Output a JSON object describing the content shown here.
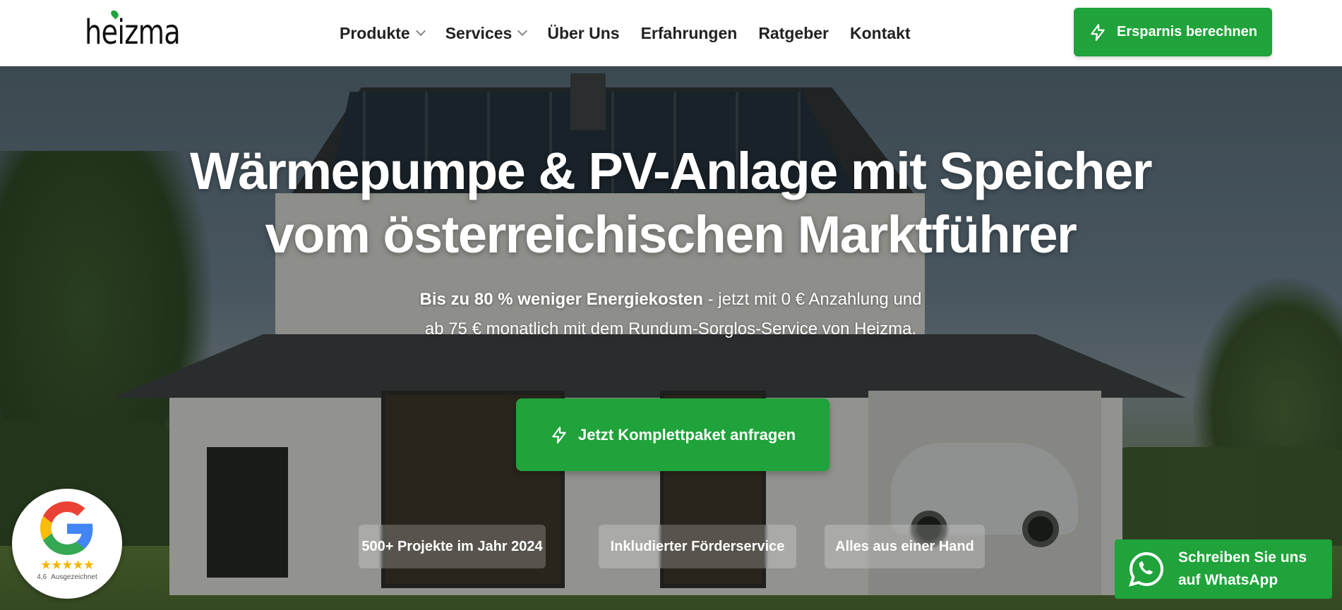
{
  "header": {
    "logo": "heizma",
    "nav": [
      {
        "label": "Produkte",
        "dropdown": true
      },
      {
        "label": "Services",
        "dropdown": true
      },
      {
        "label": "Über Uns",
        "dropdown": false
      },
      {
        "label": "Erfahrungen",
        "dropdown": false
      },
      {
        "label": "Ratgeber",
        "dropdown": false
      },
      {
        "label": "Kontakt",
        "dropdown": false
      }
    ],
    "cta_label": "Ersparnis berechnen",
    "cta_icon": "lightning-icon"
  },
  "hero": {
    "headline_line1": "Wärmepumpe & PV-Anlage mit Speicher",
    "headline_line2": "vom österreichischen Marktführer",
    "sub_bold": "Bis zu 80 % weniger Energiekosten",
    "sub_rest_line1": " - jetzt mit 0 € Anzahlung und",
    "sub_line2": "ab 75 € monatlich mit dem Rundum-Sorglos-Service von Heizma.",
    "cta_label": "Jetzt Komplettpaket anfragen",
    "pills": [
      "500+ Projekte im Jahr 2024",
      "Inkludierter Förderservice",
      "Alles aus einer Hand"
    ]
  },
  "google_badge": {
    "stars": "★★★★★",
    "rating": "4,6",
    "label": "Ausgezeichnet"
  },
  "whatsapp": {
    "line1": "Schreiben Sie uns",
    "line2_prefix": "auf ",
    "line2_brand": "WhatsApp"
  },
  "colors": {
    "accent": "#1fa33a",
    "header_bg": "#ffffff",
    "nav_text": "#222222"
  }
}
